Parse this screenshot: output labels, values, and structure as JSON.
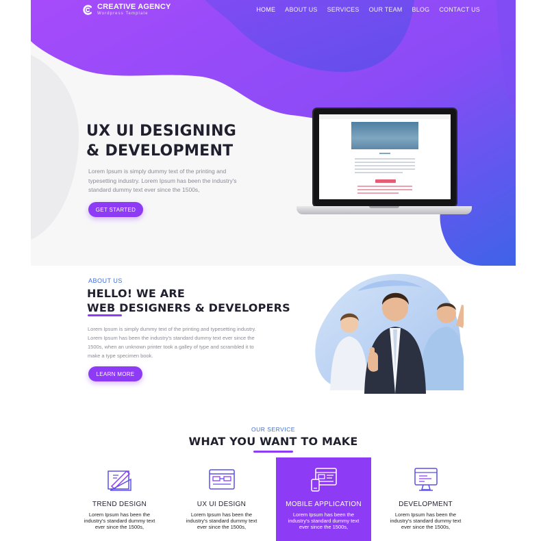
{
  "brand": {
    "title": "CREATIVE AGENCY",
    "subtitle": "Wordpress Template"
  },
  "nav": {
    "items": [
      "HOME",
      "ABOUT US",
      "SERVICES",
      "OUR TEAM",
      "BLOG",
      "CONTACT US"
    ],
    "active": "HOME"
  },
  "hero": {
    "title_line1": "UX UI DESIGNING",
    "title_line2": "& DEVELOPMENT",
    "text": "Lorem Ipsum is simply dummy text of the printing and typesetting industry. Lorem Ipsum has been the industry's standard dummy text ever since the 1500s,",
    "button": "GET STARTED"
  },
  "about": {
    "label": "ABOUT US",
    "title_line1": "HELLO! WE ARE",
    "title_line2": "WEB DESIGNERS & DEVELOPERS",
    "text": "Lorem Ipsum is simply dummy text of the printing and typesetting industry. Lorem Ipsum has been the industry's standard dummy text ever since the 1500s, when an unknown printer took a galley of type and scrambled it to make a type specimen book.",
    "button": "LEARN MORE"
  },
  "services": {
    "label": "OUR SERVICE",
    "title": "WHAT YOU WANT TO MAKE",
    "cards": [
      {
        "title": "TREND DESIGN",
        "text": "Lorem Ipsum has been the industry's standard dummy text ever since the 1500s,",
        "icon": "design-tools-icon"
      },
      {
        "title": "UX UI DESIGN",
        "text": "Lorem Ipsum has been the industry's standard dummy text ever since the 1500s,",
        "icon": "wireframe-icon"
      },
      {
        "title": "MOBILE APPLICATION",
        "text": "Lorem Ipsum has been the industry's standard dummy text ever since the 1500s,",
        "icon": "mobile-devices-icon"
      },
      {
        "title": "DEVELOPMENT",
        "text": "Lorem Ipsum has been the industry's standard dummy text ever since the 1500s,",
        "icon": "code-monitor-icon"
      }
    ]
  },
  "colors": {
    "accent": "#8e3bf5",
    "gradient_start": "#a64bfb",
    "gradient_end": "#3e63e8",
    "label_blue": "#3e6fd8",
    "dark_text": "#1f1f2e"
  }
}
